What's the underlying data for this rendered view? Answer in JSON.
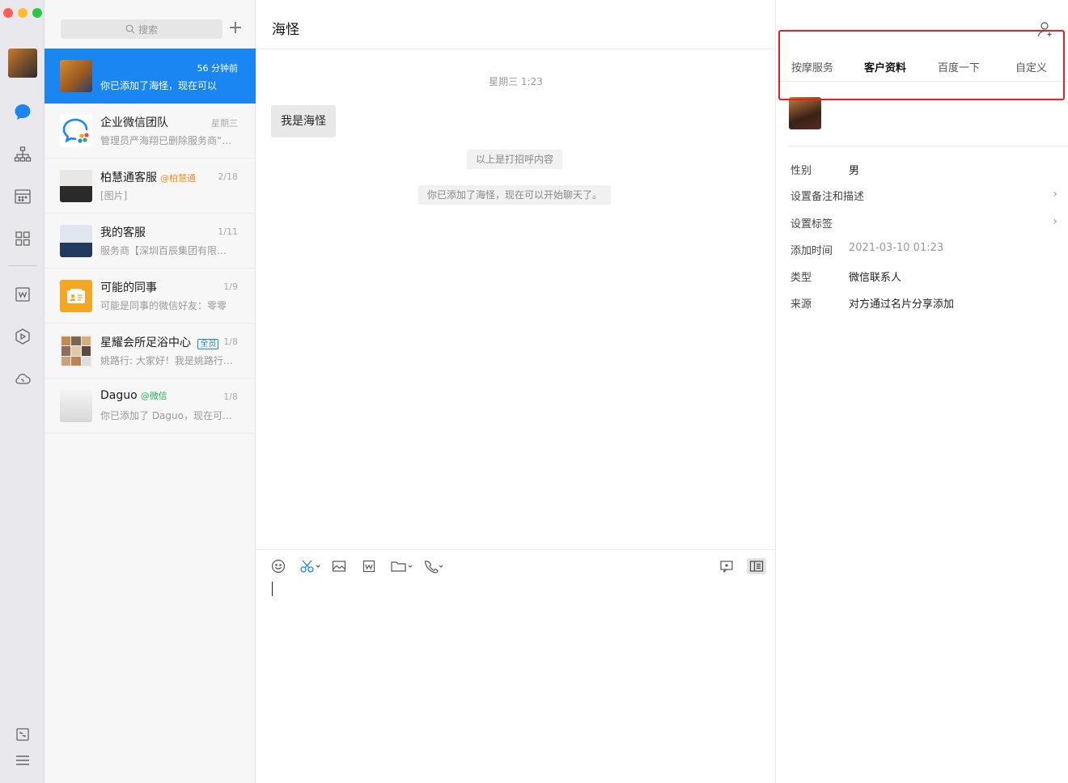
{
  "sidebar": {
    "icons": [
      "chat-bubble-icon",
      "org-chart-icon",
      "calendar-icon",
      "apps-grid-icon",
      "doc-icon",
      "hexagon-icon",
      "cloud-icon",
      "collection-icon",
      "menu-icon"
    ]
  },
  "list": {
    "search_placeholder": "搜索",
    "add_label": "+",
    "conversations": [
      {
        "name": "",
        "time": "56 分钟前",
        "preview": "你已添加了海怪，现在可以",
        "tag": ""
      },
      {
        "name": "企业微信团队",
        "time": "星期三",
        "preview": "管理员严海翔已删除服务商“…",
        "tag": ""
      },
      {
        "name": "柏慧通客服",
        "time": "2/18",
        "preview": "[图片]",
        "tag": "@柏慧通"
      },
      {
        "name": "我的客服",
        "time": "1/11",
        "preview": "服务商【深圳百辰集团有限…",
        "tag": ""
      },
      {
        "name": "可能的同事",
        "time": "1/9",
        "preview": "可能是同事的微信好友：零零",
        "tag": ""
      },
      {
        "name": "星耀会所足浴中心",
        "time": "1/8",
        "preview": "姚路行: 大家好！我是姚路行…",
        "tag": "全员"
      },
      {
        "name": "Daguo",
        "time": "1/8",
        "preview": "你已添加了 Daguo，现在可…",
        "tag": "@微信"
      }
    ]
  },
  "chat": {
    "title": "海怪",
    "date": "星期三 1:23",
    "bubble": "我是海怪",
    "sys1": "以上是打招呼内容",
    "sys2": "你已添加了海怪，现在可以开始聊天了。"
  },
  "panel": {
    "tabs": [
      "按摩服务",
      "客户资料",
      "百度一下",
      "自定义"
    ],
    "active_tab": "客户资料",
    "fields": [
      {
        "label": "性别",
        "value": "男"
      },
      {
        "label": "设置备注和描述",
        "value": ""
      },
      {
        "label": "设置标签",
        "value": ""
      },
      {
        "label": "添加时间",
        "value": "2021-03-10 01:23"
      },
      {
        "label": "类型",
        "value": "微信联系人"
      },
      {
        "label": "来源",
        "value": "对方通过名片分享添加"
      }
    ],
    "chevron": "›"
  },
  "colors": {
    "accent": "#1a86f2",
    "highlight": "#e02424"
  }
}
